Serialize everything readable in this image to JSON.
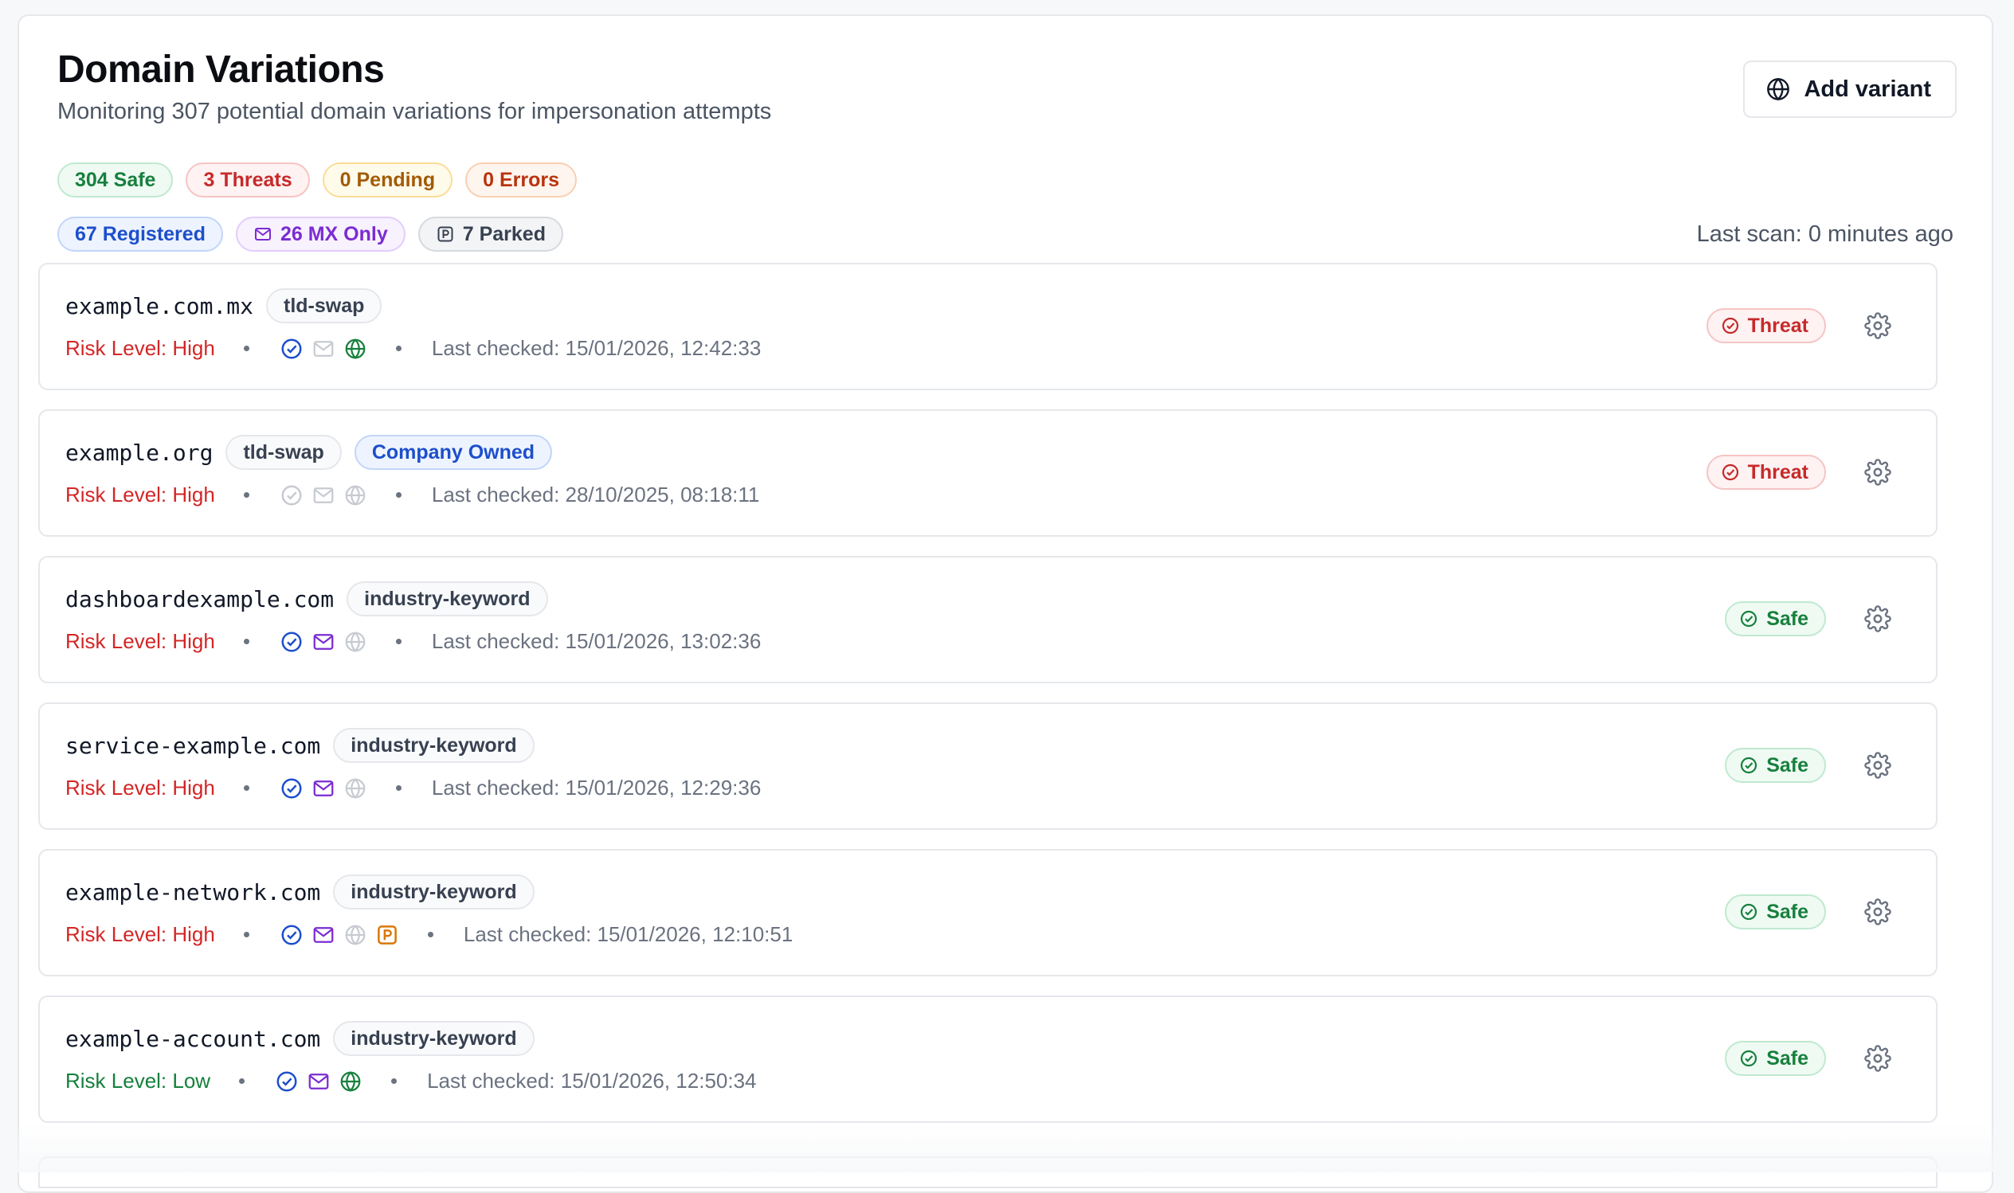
{
  "header": {
    "title": "Domain Variations",
    "subtitle": "Monitoring 307 potential domain variations for impersonation attempts",
    "add_button_label": "Add variant",
    "add_button_icon": "globe-icon"
  },
  "summary": {
    "safe": "304 Safe",
    "threats": "3 Threats",
    "pending": "0 Pending",
    "errors": "0 Errors",
    "registered": "67 Registered",
    "mx_only": "26 MX Only",
    "parked": "7 Parked"
  },
  "last_scan": "Last scan: 0 minutes ago",
  "colors": {
    "safe": "#17803d",
    "threat": "#c62a2a",
    "pending": "#a35b06",
    "error": "#b8330d",
    "registered": "#1d4fcb",
    "mx": "#7b2bd2",
    "parked_orange": "#d97706",
    "muted_icon": "#c7cbd1"
  },
  "domains": [
    {
      "domain": "example.com.mx",
      "tags": [
        "tld-swap"
      ],
      "owned": "",
      "risk": "Risk Level: High",
      "last_checked": "Last checked: 15/01/2026, 12:42:33",
      "status": "Threat"
    },
    {
      "domain": "example.org",
      "tags": [
        "tld-swap"
      ],
      "owned": "Company Owned",
      "risk": "Risk Level: High",
      "last_checked": "Last checked: 28/10/2025, 08:18:11",
      "status": "Threat"
    },
    {
      "domain": "dashboardexample.com",
      "tags": [
        "industry-keyword"
      ],
      "owned": "",
      "risk": "Risk Level: High",
      "last_checked": "Last checked: 15/01/2026, 13:02:36",
      "status": "Safe"
    },
    {
      "domain": "service-example.com",
      "tags": [
        "industry-keyword"
      ],
      "owned": "",
      "risk": "Risk Level: High",
      "last_checked": "Last checked: 15/01/2026, 12:29:36",
      "status": "Safe"
    },
    {
      "domain": "example-network.com",
      "tags": [
        "industry-keyword"
      ],
      "owned": "",
      "risk": "Risk Level: High",
      "last_checked": "Last checked: 15/01/2026, 12:10:51",
      "status": "Safe"
    },
    {
      "domain": "example-account.com",
      "tags": [
        "industry-keyword"
      ],
      "owned": "",
      "risk": "Risk Level: Low",
      "last_checked": "Last checked: 15/01/2026, 12:50:34",
      "status": "Safe"
    }
  ]
}
